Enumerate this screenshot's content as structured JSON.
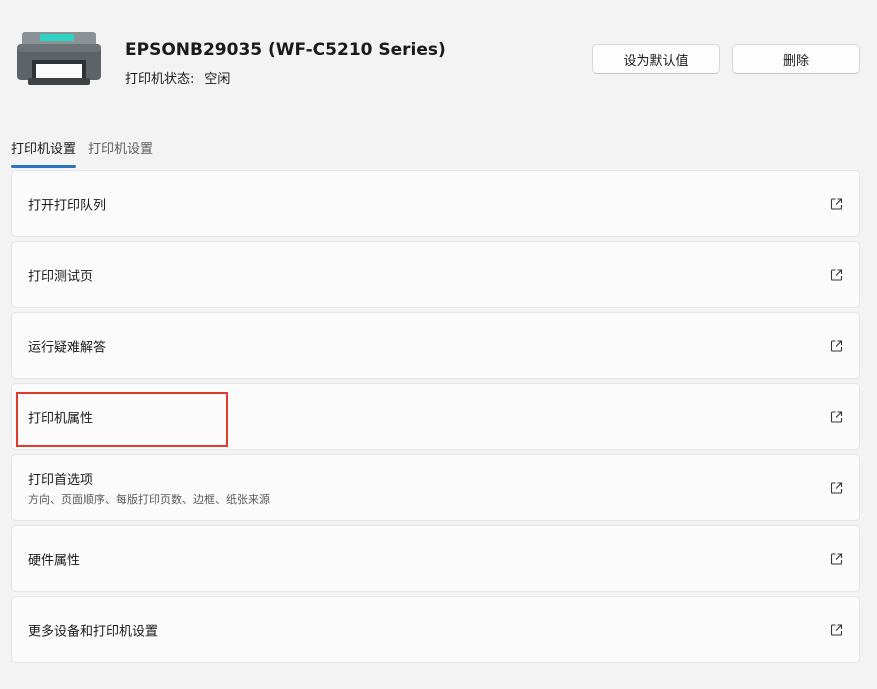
{
  "printer": {
    "name": "EPSONB29035 (WF-C5210 Series)",
    "status_label": "打印机状态:",
    "status_value": "空闲"
  },
  "buttons": {
    "set_default": "设为默认值",
    "delete": "删除"
  },
  "tabs": [
    {
      "label": "打印机设置",
      "active": true
    },
    {
      "label": "打印机设置",
      "active": false
    }
  ],
  "rows": [
    {
      "label": "打开打印队列",
      "icon": "external-link-icon"
    },
    {
      "label": "打印测试页",
      "icon": "external-link-icon"
    },
    {
      "label": "运行疑难解答",
      "icon": "external-link-icon"
    },
    {
      "label": "打印机属性",
      "icon": "external-link-icon",
      "highlighted": true
    },
    {
      "label": "打印首选项",
      "sublabel": "方向、页面顺序、每版打印页数、边框、纸张来源",
      "icon": "external-link-icon"
    },
    {
      "label": "硬件属性",
      "icon": "external-link-icon"
    },
    {
      "label": "更多设备和打印机设置",
      "icon": "external-link-icon"
    }
  ],
  "colors": {
    "accent": "#2c73c5",
    "highlight": "#e23a2b",
    "background": "#f3f3f3"
  }
}
